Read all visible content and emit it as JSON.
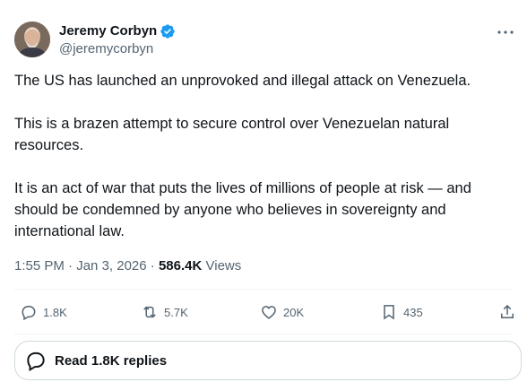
{
  "author": {
    "name": "Jeremy Corbyn",
    "handle": "@jeremycorbyn",
    "verified": true,
    "verified_color": "#1d9bf0"
  },
  "tweet": {
    "paragraphs": [
      "The US has launched an unprovoked and illegal attack on Venezuela.",
      "This is a brazen attempt to secure control over Venezuelan natural resources.",
      "It is an act of war that puts the lives of millions of people at risk — and should be condemned by anyone who believes in sovereignty and international law."
    ],
    "time": "1:55 PM",
    "date": "Jan 3, 2026",
    "views_count": "586.4K",
    "views_label": "Views"
  },
  "actions": {
    "replies": "1.8K",
    "reposts": "5.7K",
    "likes": "20K",
    "bookmarks": "435"
  },
  "read_replies_label": "Read 1.8K replies",
  "icons": [
    "verified-badge-icon",
    "more-icon",
    "reply-icon",
    "repost-icon",
    "like-icon",
    "bookmark-icon",
    "share-icon",
    "speech-bubble-icon"
  ]
}
